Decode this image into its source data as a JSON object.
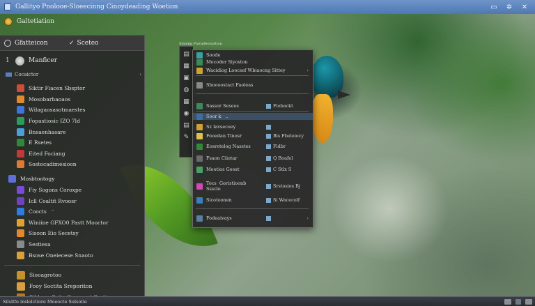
{
  "window": {
    "title": "Gallityo Pnolooe-Sloeecinng Cinoydeading Woetion"
  },
  "subbar": {
    "label": "Galtetiation"
  },
  "left_menu": {
    "header": {
      "title": "Gfatteicon",
      "check": "✓",
      "tab": "Sceteo"
    },
    "top": {
      "number": "1",
      "label": "Manficer"
    },
    "sub": {
      "label": "Cocaictor",
      "arrow": "›"
    },
    "items": [
      {
        "label": "Siktir Fiacen Sbsptor",
        "color": "#d24b3a"
      },
      {
        "label": "Mosobarhaoaos",
        "color": "#e08a2a"
      },
      {
        "label": "Wilagaosasotmaestes",
        "color": "#3b76d8"
      },
      {
        "label": "Fopastiosic  IZO  7ld",
        "color": "#2f9a5a"
      },
      {
        "label": "Bnsaenhasare",
        "color": "#4aa0d8"
      },
      {
        "label": "E  Rsetes",
        "color": "#2e8a3a"
      },
      {
        "label": "Eited Fociang",
        "color": "#c23a36"
      },
      {
        "label": "Sostocadimesioon",
        "color": "#e07a30"
      }
    ],
    "section2": {
      "label": "Mosbtootogy",
      "color": "#5f6fd8"
    },
    "items2": [
      {
        "label": "Fiy  Sogons  Coroxpe",
        "color": "#7a4ad8",
        "extra": ""
      },
      {
        "label": "Icll  Coaltit  Rvoosr",
        "color": "#6f42c1",
        "extra": ""
      },
      {
        "label": "Coocts",
        "color": "#2f7be0",
        "extra": "⌃"
      },
      {
        "label": "Winiine  GFXO0 Pastt  Mooctor",
        "color": "#e0a22a",
        "extra": ""
      },
      {
        "label": "Sisoon  Eio  Secetsy",
        "color": "#e08a2a",
        "extra": ""
      },
      {
        "label": "Sestiesa",
        "color": "#8a8a8a",
        "extra": ""
      },
      {
        "label": "Bsose  Oneiecese  Snaoto",
        "color": "#d8a040",
        "extra": ""
      }
    ],
    "bottom": [
      {
        "label": "Siooagrotoo",
        "color": "#c8902a"
      },
      {
        "label": "Fooy  Soctita  Sreporiton",
        "color": "#d8a040"
      },
      {
        "label": "Sibbeso\nSoite  Oocenoct  Sostiem",
        "color": "#b8781c"
      }
    ]
  },
  "taskbar": {
    "text": "Silsltfo inslelctiore  Moeocte Sulsotie"
  },
  "context_window": {
    "caption": "Slaolng Fiacadeouattion",
    "strip_icons": [
      "▤",
      "▦",
      "▣",
      "◍",
      "▦",
      "◉",
      "▤",
      "✎"
    ],
    "rows": [
      {
        "label": "Soode",
        "color": "#3aa0a0"
      },
      {
        "label": "Mocoder Siyoston",
        "color": "#3a8a5a"
      },
      {
        "label": "Wacidiog Loocsef Wbiaocng Sittey",
        "color": "#d0a030"
      },
      {
        "label": "Sboooostact Faoleas",
        "color": "#8a8a8a"
      },
      {
        "label": "Sassor Seseos",
        "color": "#3a8a5a",
        "right": "Fiobackt"
      },
      {
        "label": "Soor k   ..",
        "color": "#3a6fa0"
      },
      {
        "label": "Sz Iavsecoey",
        "color": "#d0a030",
        "right": ""
      },
      {
        "label": "Fooedan Tinosr",
        "color": "#e0c050",
        "right": "Bis Fbeleiocy"
      },
      {
        "label": "Eosretelog Nasstes",
        "color": "#2f8a3a",
        "right": "Fidbr"
      },
      {
        "label": "Fsaon Ciiotar",
        "color": "#6a6a6a",
        "right": "Q  Boafel"
      },
      {
        "label": "Mootios Goost",
        "color": "#4aa060",
        "right": "C  Stlx  S"
      },
      {
        "label": "Tocs  Goristioonb\nSsscle",
        "color": "#d04ab0",
        "right": "Srstosies  Bj"
      },
      {
        "label": "Sicotoonen",
        "color": "#3a80c0",
        "right": "Si  Wacecolf"
      },
      {
        "label": "Fodeaivays",
        "color": "#5a7fa0",
        "right": ""
      }
    ]
  }
}
